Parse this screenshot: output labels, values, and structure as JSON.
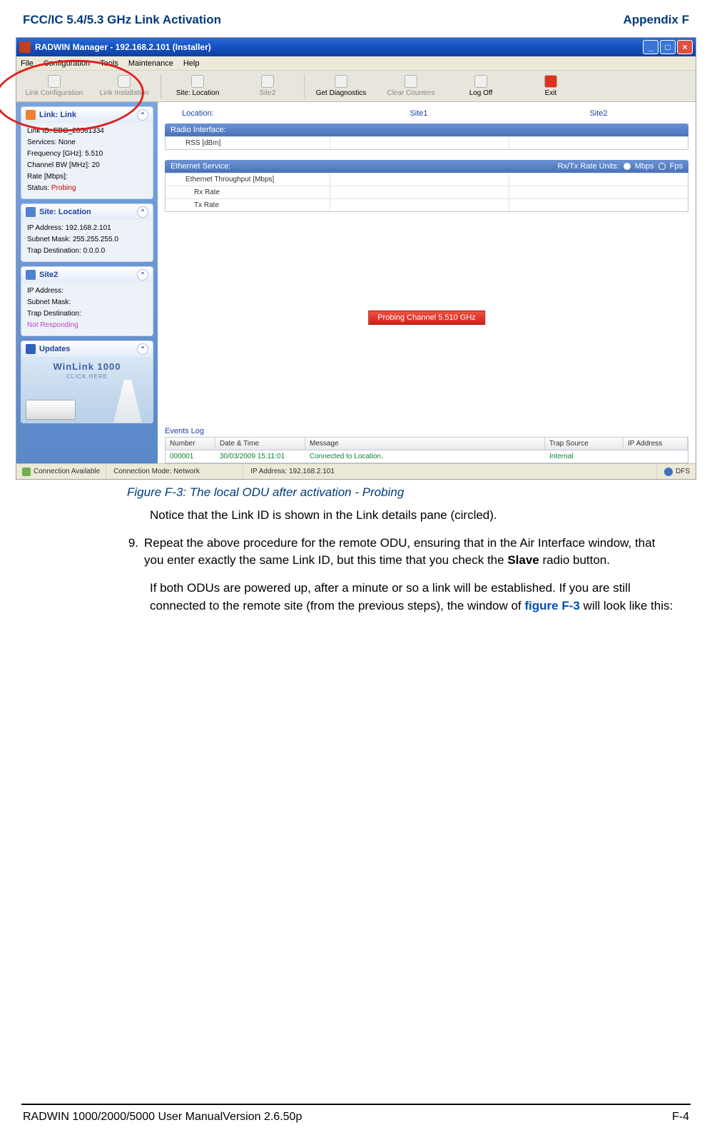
{
  "header": {
    "left": "FCC/IC 5.4/5.3 GHz Link Activation",
    "right": "Appendix F"
  },
  "window": {
    "title": "RADWIN Manager - 192.168.2.101 (Installer)"
  },
  "menubar": [
    "File",
    "Configuration",
    "Tools",
    "Maintenance",
    "Help"
  ],
  "toolbar": {
    "link_config": "Link Configuration",
    "link_install": "Link Installation",
    "site_location": "Site: Location",
    "site2": "Site2",
    "get_diag": "Get Diagnostics",
    "clear_counters": "Clear Counters",
    "log_off": "Log Off",
    "exit": "Exit"
  },
  "sidebar": {
    "link_panel": {
      "title": "Link: Link",
      "rows": {
        "link_id_label": "Link ID:",
        "link_id_value": "EBG_20561334",
        "services_label": "Services:",
        "services_value": "None",
        "freq_label": "Frequency [GHz]:",
        "freq_value": "5.510",
        "bw_label": "Channel BW [MHz]:",
        "bw_value": "20",
        "rate_label": "Rate [Mbps]:",
        "rate_value": "",
        "status_label": "Status:",
        "status_value": "Probing"
      }
    },
    "site_loc_panel": {
      "title": "Site: Location",
      "rows": {
        "ip_label": "IP Address:",
        "ip_value": "192.168.2.101",
        "mask_label": "Subnet Mask:",
        "mask_value": "255.255.255.0",
        "trap_label": "Trap Destination:",
        "trap_value": "0.0.0.0"
      }
    },
    "site2_panel": {
      "title": "Site2",
      "rows": {
        "ip_label": "IP Address:",
        "mask_label": "Subnet Mask:",
        "trap_label": "Trap Destination:",
        "status_value": "Not Responding"
      }
    },
    "updates_panel": {
      "title": "Updates",
      "ad_title": "WinLink 1000",
      "ad_sub": "CLICK HERE"
    }
  },
  "main": {
    "loc_label": "Location:",
    "site1": "Site1",
    "site2": "Site2",
    "radio_head": "Radio Interface:",
    "rss": "RSS [dBm]",
    "eth_head": "Ethernet Service:",
    "rxtx_label": "Rx/Tx Rate Units:",
    "mbps": "Mbps",
    "fps": "Fps",
    "eth_throughput": "Ethernet Throughput [Mbps]",
    "rx_rate": "Rx Rate",
    "tx_rate": "Tx Rate",
    "probing_banner": "Probing Channel 5.510 GHz",
    "events_label": "Events Log",
    "events_columns": {
      "number": "Number",
      "datetime": "Date & Time",
      "message": "Message",
      "trap": "Trap Source",
      "ip": "IP Address"
    },
    "events_row": {
      "number": "000001",
      "datetime": "30/03/2009 15:11:01",
      "message": "Connected to Location.",
      "trap": "Internal",
      "ip": ""
    }
  },
  "statusbar": {
    "conn": "Connection Available",
    "mode": "Connection Mode: Network",
    "ip": "IP Address: 192.168.2.101",
    "dfs": "DFS"
  },
  "figure_caption": "Figure F-3: The local ODU after activation - Probing",
  "body": {
    "p1": "Notice that the Link ID is shown in the Link details pane (circled).",
    "num9": "9.",
    "p2a": "Repeat the above procedure for the remote ODU, ensuring that in the Air Interface window, that you enter exactly the same Link ID, but this time that you check the ",
    "slave": "Slave",
    "p2b": " radio button.",
    "p3a": "If both ODUs are powered up, after a minute or so a link will be estab­lished. If you are still connected to the remote site (from the previous steps), the window of ",
    "figlink": "figure F-3",
    "p3b": " will look like this:"
  },
  "footer": {
    "left": "RADWIN 1000/2000/5000 User ManualVersion  2.6.50p",
    "right": "F-4"
  }
}
